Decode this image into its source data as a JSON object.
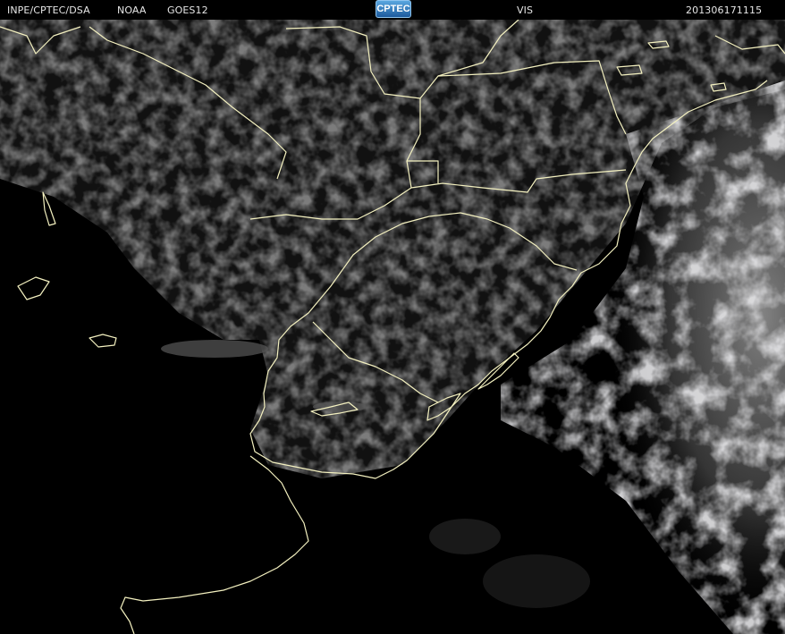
{
  "header": {
    "organization": "INPE/CPTEC/DSA",
    "agency": "NOAA",
    "satellite": "GOES12",
    "logo_text": "CPTEC",
    "channel": "VIS",
    "timestamp": "201306171115"
  },
  "colors": {
    "background": "#000000",
    "land": "#2b2b2b",
    "cloud": "#bfbfbf",
    "border_lines": "#f4f1c0",
    "header_text": "#e6e6e6"
  }
}
